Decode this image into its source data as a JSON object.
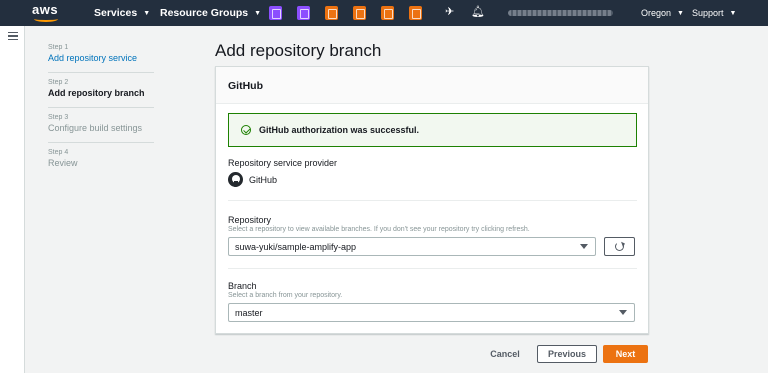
{
  "topnav": {
    "brand": "aws",
    "services_label": "Services",
    "resource_groups_label": "Resource Groups",
    "service_icons": [
      {
        "name": "purple-service-icon",
        "color": "#8c4fff"
      },
      {
        "name": "purple-service-icon-2",
        "color": "#8c4fff"
      },
      {
        "name": "orange-service-icon",
        "color": "#ec7211"
      },
      {
        "name": "orange-service-icon-2",
        "color": "#ec7211"
      },
      {
        "name": "orange-service-icon-3",
        "color": "#ec7211"
      },
      {
        "name": "orange-service-icon-4",
        "color": "#ec7211"
      }
    ],
    "region_label": "Oregon",
    "support_label": "Support"
  },
  "steps": [
    {
      "num": "Step 1",
      "label": "Add repository service",
      "state": "link"
    },
    {
      "num": "Step 2",
      "label": "Add repository branch",
      "state": "active"
    },
    {
      "num": "Step 3",
      "label": "Configure build settings",
      "state": "pending"
    },
    {
      "num": "Step 4",
      "label": "Review",
      "state": "pending"
    }
  ],
  "page": {
    "title": "Add repository branch"
  },
  "panel": {
    "header": "GitHub",
    "alert_text": "GitHub authorization was successful.",
    "provider_label": "Repository service provider",
    "provider_name": "GitHub",
    "repository_label": "Repository",
    "repository_desc": "Select a repository to view available branches. If you don't see your repository try clicking refresh.",
    "repository_value": "suwa-yuki/sample-amplify-app",
    "branch_label": "Branch",
    "branch_desc": "Select a branch from your repository.",
    "branch_value": "master"
  },
  "footer": {
    "cancel_label": "Cancel",
    "previous_label": "Previous",
    "next_label": "Next"
  },
  "colors": {
    "nav_bg": "#232f3e",
    "accent": "#ec7211",
    "success": "#1d8102",
    "link": "#0073bb"
  }
}
